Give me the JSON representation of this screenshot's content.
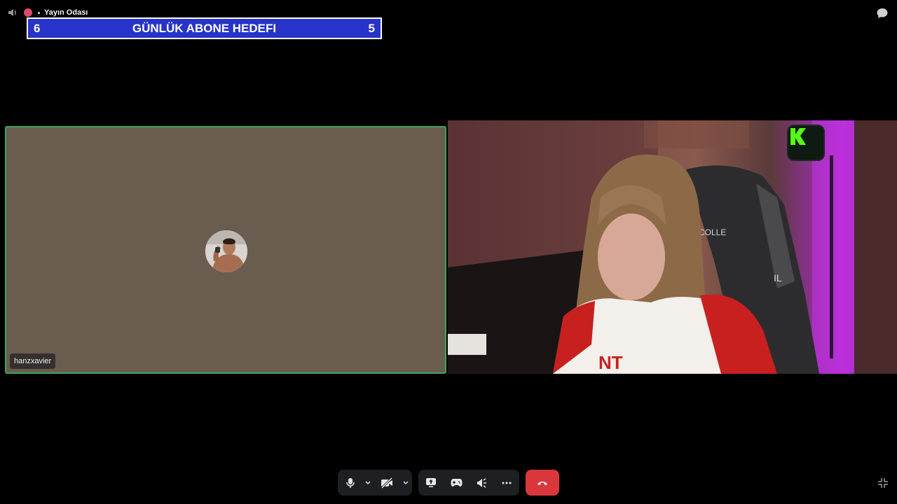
{
  "channel": {
    "name": "Yayın Odası",
    "icons": {
      "left": "speaker-hand-icon",
      "server": "server-dot-icon",
      "chat": "chat-bubble-icon"
    }
  },
  "goal_banner": {
    "left_value": "6",
    "title": "GÜNLÜK ABONE HEDEFI",
    "right_value": "5",
    "color": "#2733c9"
  },
  "participants": {
    "left": {
      "username": "hanzxavier",
      "tile_color": "#6b5c50",
      "speaking_border": "#3ba55c"
    },
    "right": {
      "badge_letter": "K",
      "chair_text": "COLLE",
      "chair_text_2": "IL"
    }
  },
  "controls": {
    "microphone": "microphone-icon",
    "mic_options": "chevron-down-icon",
    "camera": "camera-off-icon",
    "camera_options": "chevron-down-icon",
    "screen_share": "screen-share-icon",
    "activities": "gamepad-icon",
    "soundboard": "soundboard-icon",
    "more": "more-icon",
    "disconnect": "hangup-icon",
    "disconnect_color": "#da373c",
    "fullscreen": "collapse-icon"
  }
}
